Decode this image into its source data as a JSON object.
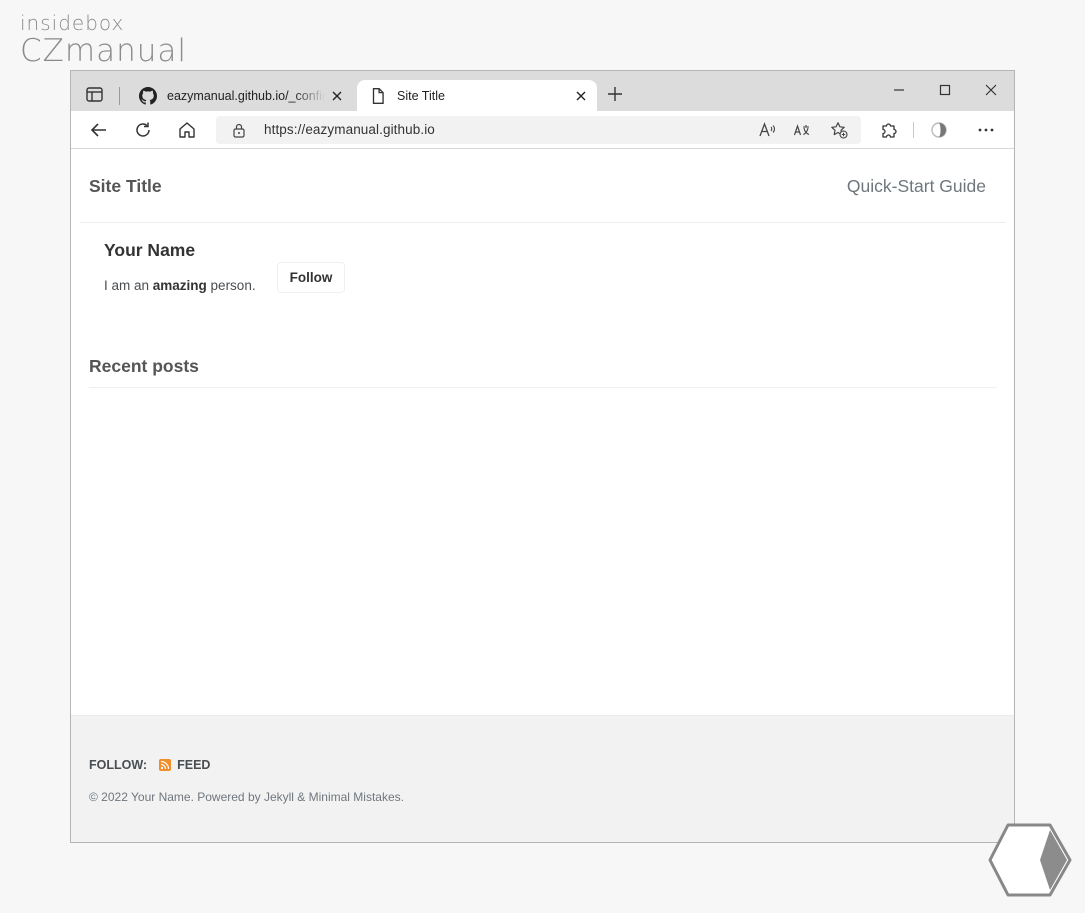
{
  "watermark": {
    "line1": "insidebox",
    "line2": "CZmanual"
  },
  "browser": {
    "tabs": [
      {
        "label": "eazymanual.github.io/_config.yml",
        "favicon": "github-icon"
      },
      {
        "label": "Site Title",
        "favicon": "page-icon",
        "active": true
      }
    ],
    "address": {
      "url": "https://eazymanual.github.io"
    }
  },
  "site": {
    "title": "Site Title",
    "nav": {
      "quick_start": "Quick-Start Guide"
    }
  },
  "author": {
    "name": "Your Name",
    "bio_prefix": "I am an ",
    "bio_bold": "amazing",
    "bio_suffix": " person.",
    "follow_label": "Follow"
  },
  "main": {
    "recent_posts_heading": "Recent posts"
  },
  "footer": {
    "follow_label": "FOLLOW:",
    "feed_label": "FEED",
    "copyright": "© 2022 Your Name. Powered by Jekyll & Minimal Mistakes."
  },
  "colors": {
    "rss": "#ef8e2a",
    "tabbar": "#dcdcdc",
    "footer_bg": "#f2f2f3"
  }
}
